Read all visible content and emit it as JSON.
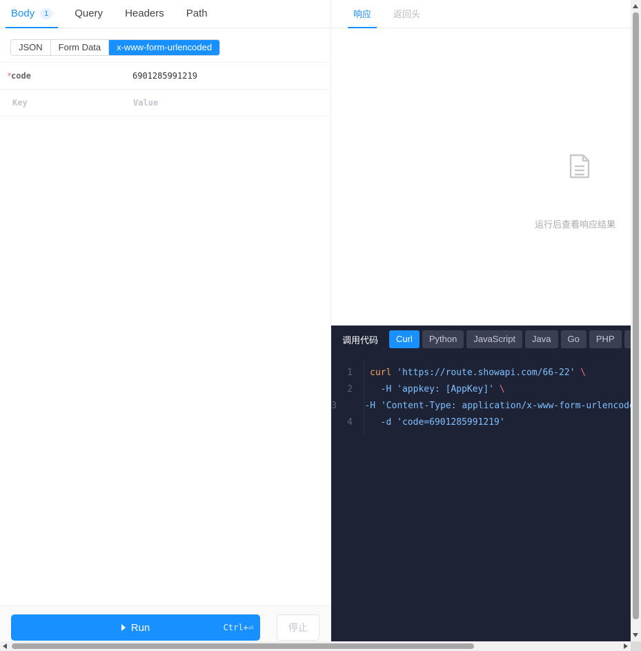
{
  "request_tabs": [
    {
      "label": "Body",
      "badge": "1",
      "active": true
    },
    {
      "label": "Query"
    },
    {
      "label": "Headers"
    },
    {
      "label": "Path"
    }
  ],
  "body_types": [
    "JSON",
    "Form Data",
    "x-www-form-urlencoded"
  ],
  "body_type_selected": "x-www-form-urlencoded",
  "params": [
    {
      "required_mark": "*",
      "key": "code",
      "value": "6901285991219"
    }
  ],
  "new_param": {
    "key_placeholder": "Key",
    "value_placeholder": "Value"
  },
  "actions": {
    "run_label": "Run",
    "run_shortcut": "Ctrl+⏎",
    "stop_label": "停止"
  },
  "response_tabs": [
    {
      "label": "响应",
      "active": true
    },
    {
      "label": "返回头"
    }
  ],
  "response_empty_text": "运行后查看响应结果",
  "code_panel": {
    "title": "调用代码",
    "languages": [
      "Curl",
      "Python",
      "JavaScript",
      "Java",
      "Go",
      "PHP",
      "C#"
    ],
    "selected_language": "Curl",
    "lines": [
      {
        "num": "1",
        "cmd": "curl",
        "flag": "",
        "arg": "'https://route.showapi.com/66-22'",
        "cont": "\\"
      },
      {
        "num": "2",
        "cmd": "",
        "flag": "-H",
        "arg": "'appkey: [AppKey]'",
        "cont": "\\"
      },
      {
        "num": "3",
        "cmd": "",
        "flag": "-H",
        "arg": "'Content-Type: application/x-www-form-urlencoded'",
        "cont": ""
      },
      {
        "num": "4",
        "cmd": "",
        "flag": "-d",
        "arg": "'code=6901285991219'",
        "cont": ""
      }
    ]
  },
  "colors": {
    "accent": "#1890ff",
    "code_bg": "#1e2235",
    "keyword": "#f0a456",
    "string": "#7ec0ff",
    "backslash": "#f26d7d"
  }
}
